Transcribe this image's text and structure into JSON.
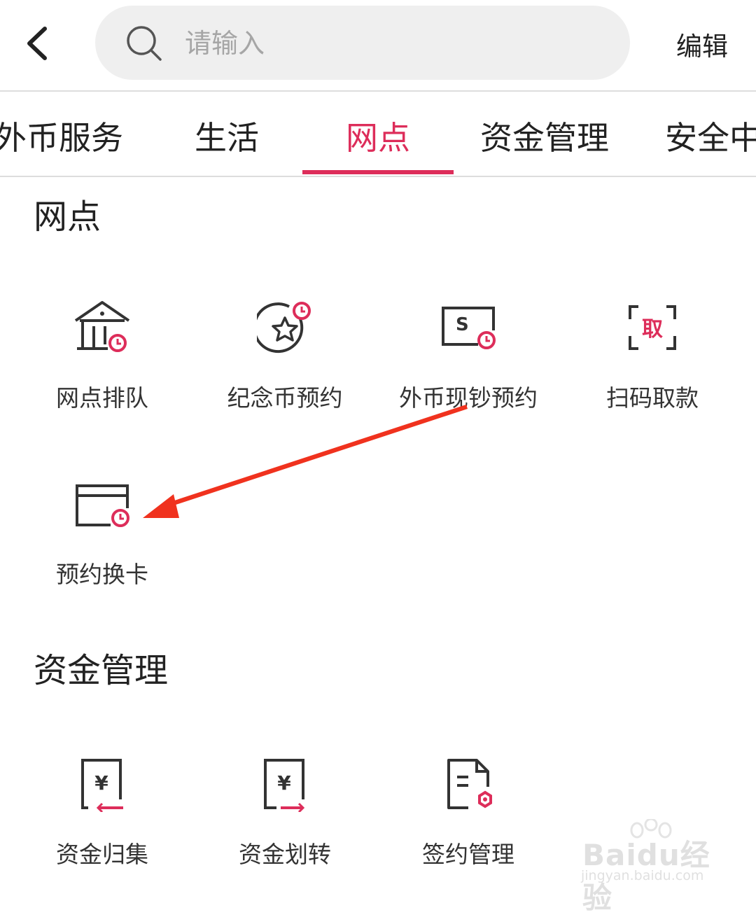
{
  "header": {
    "back_icon": "chevron-left-icon",
    "search_icon": "search-icon",
    "search_placeholder": "请输入",
    "search_value": "",
    "edit_label": "编辑"
  },
  "tabs": [
    {
      "label": "外币服务"
    },
    {
      "label": "生活"
    },
    {
      "label": "网点",
      "active": true
    },
    {
      "label": "资金管理"
    },
    {
      "label": "安全中"
    }
  ],
  "sections": [
    {
      "title": "网点",
      "items": [
        {
          "label": "网点排队",
          "icon": "bank-branch-clock-icon"
        },
        {
          "label": "纪念币预约",
          "icon": "coin-star-clock-icon"
        },
        {
          "label": "外币现钞预约",
          "icon": "dollar-bill-clock-icon"
        },
        {
          "label": "扫码取款",
          "icon": "scan-withdraw-icon",
          "icon_text": "取"
        },
        {
          "label": "预约换卡",
          "icon": "card-clock-icon"
        }
      ]
    },
    {
      "title": "资金管理",
      "items": [
        {
          "label": "资金归集",
          "icon": "yuan-doc-collect-icon",
          "icon_text": "¥"
        },
        {
          "label": "资金划转",
          "icon": "yuan-doc-transfer-icon",
          "icon_text": "¥"
        },
        {
          "label": "签约管理",
          "icon": "contract-doc-icon"
        }
      ]
    }
  ],
  "watermark": {
    "text": "Baidu经验",
    "sub": "jingyan.baidu.com"
  },
  "colors": {
    "accent": "#dd2d5a",
    "annotation_arrow": "#f0321e",
    "text": "#333333",
    "divider": "#dddddd"
  }
}
